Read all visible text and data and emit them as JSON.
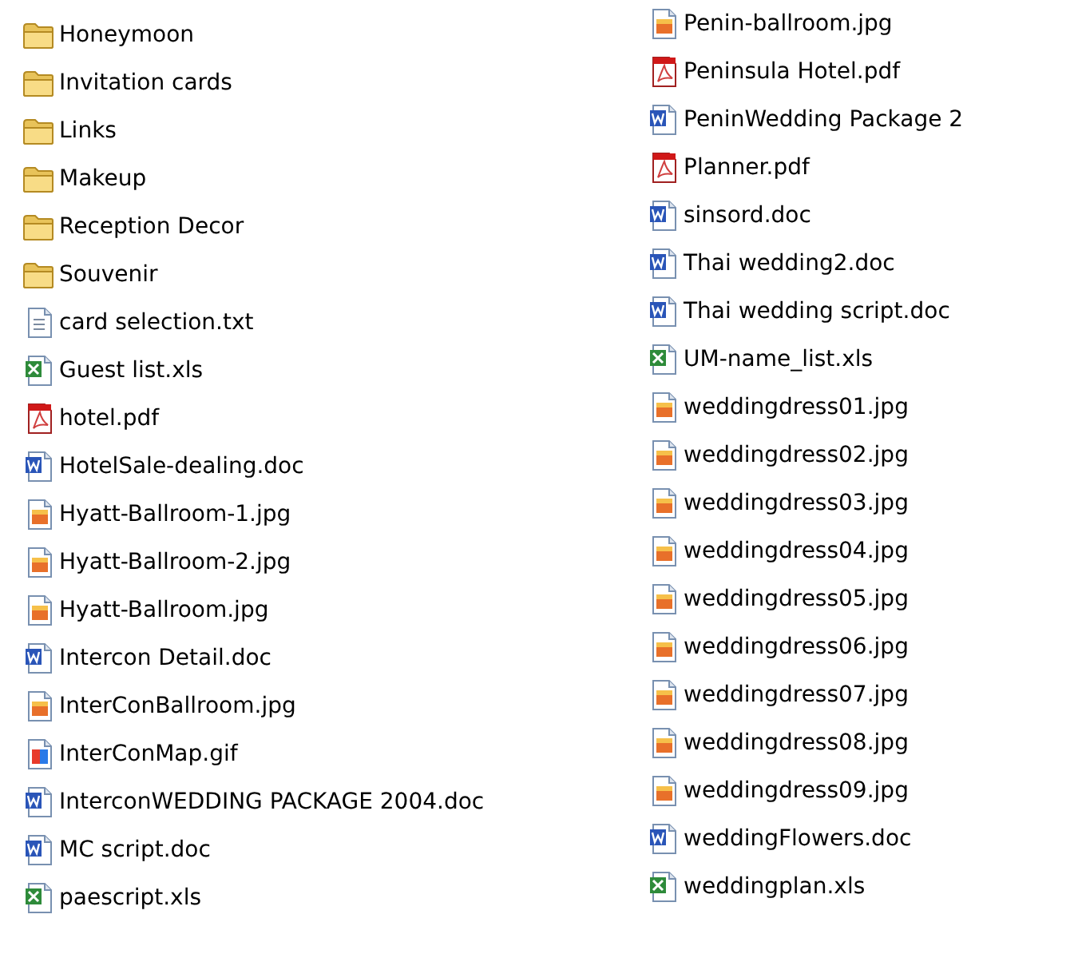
{
  "file_columns": [
    {
      "items": [
        {
          "name": "Honeymoon",
          "kind": "folder"
        },
        {
          "name": "Invitation cards",
          "kind": "folder"
        },
        {
          "name": "Links",
          "kind": "folder"
        },
        {
          "name": "Makeup",
          "kind": "folder"
        },
        {
          "name": "Reception Decor",
          "kind": "folder"
        },
        {
          "name": "Souvenir",
          "kind": "folder"
        },
        {
          "name": "card selection.txt",
          "kind": "txt"
        },
        {
          "name": "Guest list.xls",
          "kind": "xls"
        },
        {
          "name": "hotel.pdf",
          "kind": "pdf"
        },
        {
          "name": "HotelSale-dealing.doc",
          "kind": "doc"
        },
        {
          "name": "Hyatt-Ballroom-1.jpg",
          "kind": "jpg"
        },
        {
          "name": "Hyatt-Ballroom-2.jpg",
          "kind": "jpg"
        },
        {
          "name": "Hyatt-Ballroom.jpg",
          "kind": "jpg"
        },
        {
          "name": "Intercon Detail.doc",
          "kind": "doc"
        },
        {
          "name": "InterConBallroom.jpg",
          "kind": "jpg"
        },
        {
          "name": "InterConMap.gif",
          "kind": "gif"
        },
        {
          "name": "InterconWEDDING PACKAGE 2004.doc",
          "kind": "doc"
        },
        {
          "name": "MC script.doc",
          "kind": "doc"
        },
        {
          "name": "paescript.xls",
          "kind": "xls"
        }
      ]
    },
    {
      "items": [
        {
          "name": "Penin-ballroom.jpg",
          "kind": "jpg"
        },
        {
          "name": "Peninsula Hotel.pdf",
          "kind": "pdf"
        },
        {
          "name": "PeninWedding Package 2",
          "kind": "doc"
        },
        {
          "name": "Planner.pdf",
          "kind": "pdf"
        },
        {
          "name": "sinsord.doc",
          "kind": "doc"
        },
        {
          "name": "Thai wedding2.doc",
          "kind": "doc"
        },
        {
          "name": "Thai wedding script.doc",
          "kind": "doc"
        },
        {
          "name": "UM-name_list.xls",
          "kind": "xls"
        },
        {
          "name": "weddingdress01.jpg",
          "kind": "jpg"
        },
        {
          "name": "weddingdress02.jpg",
          "kind": "jpg"
        },
        {
          "name": "weddingdress03.jpg",
          "kind": "jpg"
        },
        {
          "name": "weddingdress04.jpg",
          "kind": "jpg"
        },
        {
          "name": "weddingdress05.jpg",
          "kind": "jpg"
        },
        {
          "name": "weddingdress06.jpg",
          "kind": "jpg"
        },
        {
          "name": "weddingdress07.jpg",
          "kind": "jpg"
        },
        {
          "name": "weddingdress08.jpg",
          "kind": "jpg"
        },
        {
          "name": "weddingdress09.jpg",
          "kind": "jpg"
        },
        {
          "name": "weddingFlowers.doc",
          "kind": "doc"
        },
        {
          "name": "weddingplan.xls",
          "kind": "xls"
        }
      ]
    }
  ]
}
